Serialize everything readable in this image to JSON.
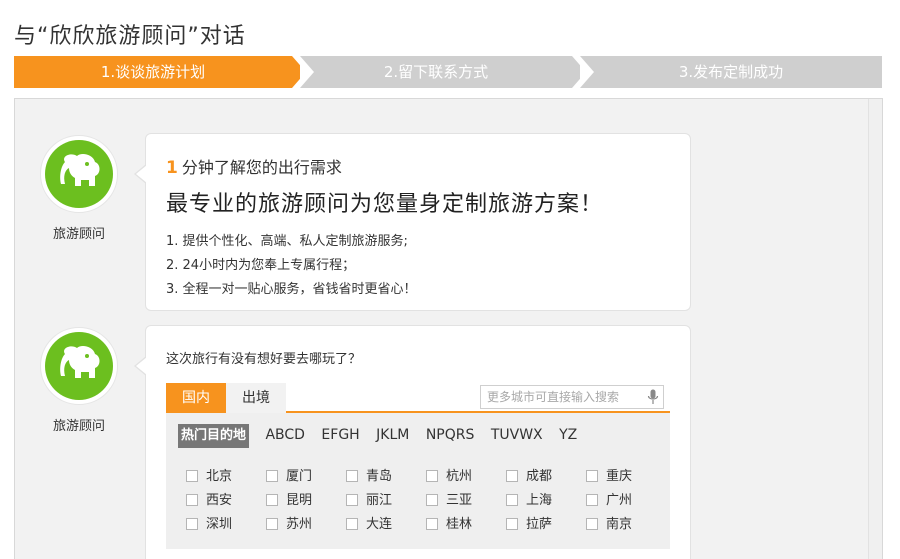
{
  "page": {
    "title": "与“欣欣旅游顾问”对话"
  },
  "steps": [
    "1.谈谈旅游计划",
    "2.留下联系方式",
    "3.发布定制成功"
  ],
  "agent": {
    "name": "旅游顾问",
    "avatar_icon": "elephant-icon"
  },
  "intro": {
    "num": "1",
    "line1": "分钟了解您的出行需求",
    "line2": "最专业的旅游顾问为您量身定制旅游方案！",
    "bullets": [
      "1. 提供个性化、高端、私人定制旅游服务;",
      "2. 24小时内为您奉上专属行程；",
      "3. 全程一对一贴心服务，省钱省时更省心！"
    ]
  },
  "destination": {
    "question": "这次旅行有没有想好要去哪玩了？",
    "tabs": [
      "国内",
      "出境"
    ],
    "search_placeholder": "更多城市可直接输入搜索",
    "letter_tabs": [
      "热门目的地",
      "ABCD",
      "EFGH",
      "JKLM",
      "NPQRS",
      "TUVWX",
      "YZ"
    ],
    "cities": [
      [
        "北京",
        "厦门",
        "青岛",
        "杭州",
        "成都",
        "重庆"
      ],
      [
        "西安",
        "昆明",
        "丽江",
        "三亚",
        "上海",
        "广州"
      ],
      [
        "深圳",
        "苏州",
        "大连",
        "桂林",
        "拉萨",
        "南京"
      ]
    ]
  },
  "colors": {
    "accent": "#f7931e",
    "avatar_green": "#6cbf1f",
    "step_inactive": "#cfcfcf"
  }
}
